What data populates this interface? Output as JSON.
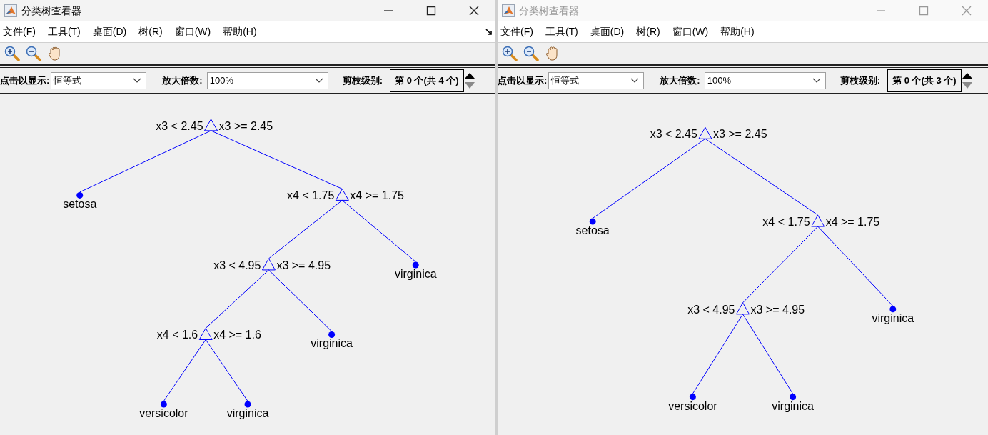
{
  "windows": [
    {
      "title": "分类树查看器",
      "active": true,
      "dock_button": true,
      "menu": [
        "文件(F)",
        "工具(T)",
        "桌面(D)",
        "树(R)",
        "窗口(W)",
        "帮助(H)"
      ],
      "controls": {
        "display_label": "点击以显示:",
        "display_value": "恒等式",
        "zoom_label": "放大倍数:",
        "zoom_value": "100%",
        "prune_label": "剪枝级别:",
        "prune_value": "第 0 个(共 4 个)"
      },
      "tree": {
        "kind": "split",
        "left_label": "x3 < 2.45",
        "right_label": "x3 >= 2.45",
        "children": [
          {
            "kind": "leaf",
            "label": "setosa"
          },
          {
            "kind": "split",
            "left_label": "x4 < 1.75",
            "right_label": "x4 >= 1.75",
            "children": [
              {
                "kind": "split",
                "left_label": "x3 < 4.95",
                "right_label": "x3 >= 4.95",
                "children": [
                  {
                    "kind": "split",
                    "left_label": "x4 < 1.6",
                    "right_label": "x4 >= 1.6",
                    "children": [
                      {
                        "kind": "leaf",
                        "label": "versicolor"
                      },
                      {
                        "kind": "leaf",
                        "label": "virginica"
                      }
                    ]
                  },
                  {
                    "kind": "leaf",
                    "label": "virginica"
                  }
                ]
              },
              {
                "kind": "leaf",
                "label": "virginica"
              }
            ]
          }
        ]
      }
    },
    {
      "title": "分类树查看器",
      "active": false,
      "dock_button": false,
      "menu": [
        "文件(F)",
        "工具(T)",
        "桌面(D)",
        "树(R)",
        "窗口(W)",
        "帮助(H)"
      ],
      "controls": {
        "display_label": "点击以显示:",
        "display_value": "恒等式",
        "zoom_label": "放大倍数:",
        "zoom_value": "100%",
        "prune_label": "剪枝级别:",
        "prune_value": "第 0 个(共 3 个)"
      },
      "tree": {
        "kind": "split",
        "left_label": "x3 < 2.45",
        "right_label": "x3 >= 2.45",
        "children": [
          {
            "kind": "leaf",
            "label": "setosa"
          },
          {
            "kind": "split",
            "left_label": "x4 < 1.75",
            "right_label": "x4 >= 1.75",
            "children": [
              {
                "kind": "split",
                "left_label": "x3 < 4.95",
                "right_label": "x3 >= 4.95",
                "children": [
                  {
                    "kind": "leaf",
                    "label": "versicolor"
                  },
                  {
                    "kind": "leaf",
                    "label": "virginica"
                  }
                ]
              },
              {
                "kind": "leaf",
                "label": "virginica"
              }
            ]
          }
        ]
      }
    }
  ]
}
